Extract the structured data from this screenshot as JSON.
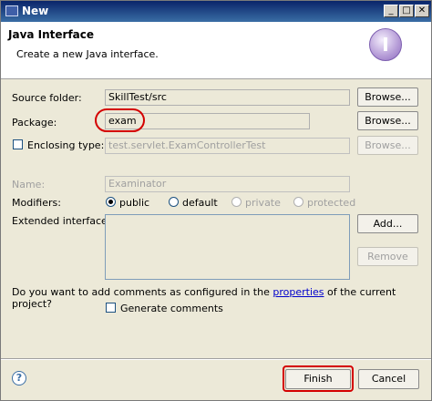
{
  "window": {
    "title": "New",
    "min_icon": "minimize-icon",
    "max_icon": "maximize-icon",
    "close_icon": "close-icon",
    "min_glyph": "_",
    "max_glyph": "□",
    "close_glyph": "✕"
  },
  "header": {
    "title": "Java Interface",
    "description": "Create a new Java interface.",
    "icon_glyph": "I"
  },
  "form": {
    "source_folder": {
      "label": "Source folder:",
      "value": "SkillTest/src",
      "browse": "Browse..."
    },
    "package": {
      "label": "Package:",
      "value": "exam",
      "browse": "Browse..."
    },
    "enclosing_type": {
      "label": "Enclosing type:",
      "value": "test.servlet.ExamControllerTest",
      "browse": "Browse...",
      "checked": false
    },
    "name": {
      "label": "Name:",
      "value": "Examinator"
    },
    "modifiers": {
      "label": "Modifiers:",
      "options": [
        "public",
        "default",
        "private",
        "protected"
      ],
      "selected": "public"
    },
    "extended_interfaces": {
      "label": "Extended interfaces:",
      "add": "Add...",
      "remove": "Remove"
    },
    "comments": {
      "question_pre": "Do you want to add comments as configured in the",
      "link": "properties",
      "question_post": "of the current project?",
      "generate_label": "Generate comments",
      "checked": false
    }
  },
  "footer": {
    "help_glyph": "?",
    "finish": "Finish",
    "cancel": "Cancel"
  },
  "colors": {
    "highlight": "#d40000",
    "titlebar": "#0a246a"
  }
}
